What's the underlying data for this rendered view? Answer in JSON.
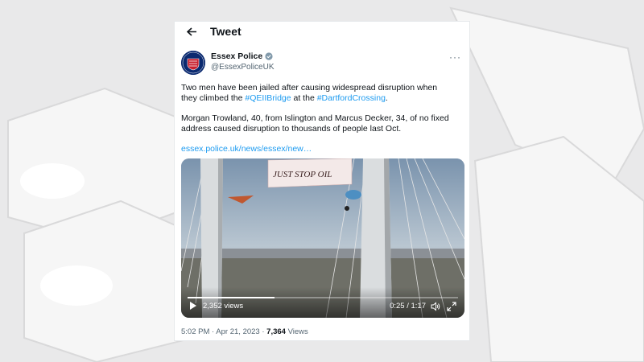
{
  "colors": {
    "link": "#1d9bf0",
    "text": "#0f1419",
    "muted": "#536471",
    "verified": "#829aab",
    "avatar_bg": "#0b2a70"
  },
  "topbar": {
    "title": "Tweet",
    "back_icon": "arrow-left-icon"
  },
  "author": {
    "display_name": "Essex Police",
    "handle": "@EssexPoliceUK",
    "avatar_text": "ESSEX POLICE",
    "verified_icon": "verified-badge-icon"
  },
  "tweet": {
    "p1_pre": "Two men have been jailed after causing widespread disruption when they climbed the ",
    "p1_tag1": "#QEIIBridge",
    "p1_mid": " at the ",
    "p1_tag2": "#DartfordCrossing",
    "p1_post": ".",
    "p2": "Morgan Trowland, 40, from Islington and Marcus Decker, 34, of no fixed address caused disruption to thousands of people last Oct.",
    "link": "essex.police.uk/news/essex/new…"
  },
  "video": {
    "banner_text": "JUST STOP OIL",
    "views": "2,352 views",
    "timecode": "0:25 / 1:17",
    "progress_fraction": 0.32
  },
  "meta": {
    "time": "5:02 PM · Apr 21, 2023 · ",
    "views_count": "7,364",
    "views_label": " Views"
  }
}
